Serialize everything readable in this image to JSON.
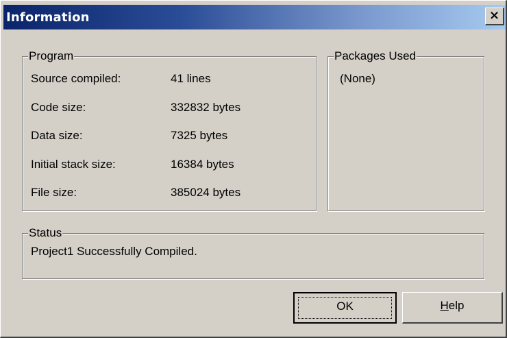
{
  "window": {
    "title": "Information",
    "close_glyph": "×"
  },
  "program": {
    "legend": "Program",
    "rows": [
      {
        "label": "Source compiled:",
        "value": "41 lines"
      },
      {
        "label": "Code size:",
        "value": "332832 bytes"
      },
      {
        "label": "Data size:",
        "value": "7325 bytes"
      },
      {
        "label": "Initial stack size:",
        "value": "16384 bytes"
      },
      {
        "label": "File size:",
        "value": "385024 bytes"
      }
    ]
  },
  "packages": {
    "legend": "Packages Used",
    "content": "(None)"
  },
  "status": {
    "legend": "Status",
    "message": "Project1 Successfully Compiled."
  },
  "buttons": {
    "ok_label": "OK",
    "help_mnemonic": "H",
    "help_rest": "elp"
  },
  "colors": {
    "title_start": "#0a246a",
    "title_end": "#a6caf0",
    "face": "#d4d0c8"
  }
}
